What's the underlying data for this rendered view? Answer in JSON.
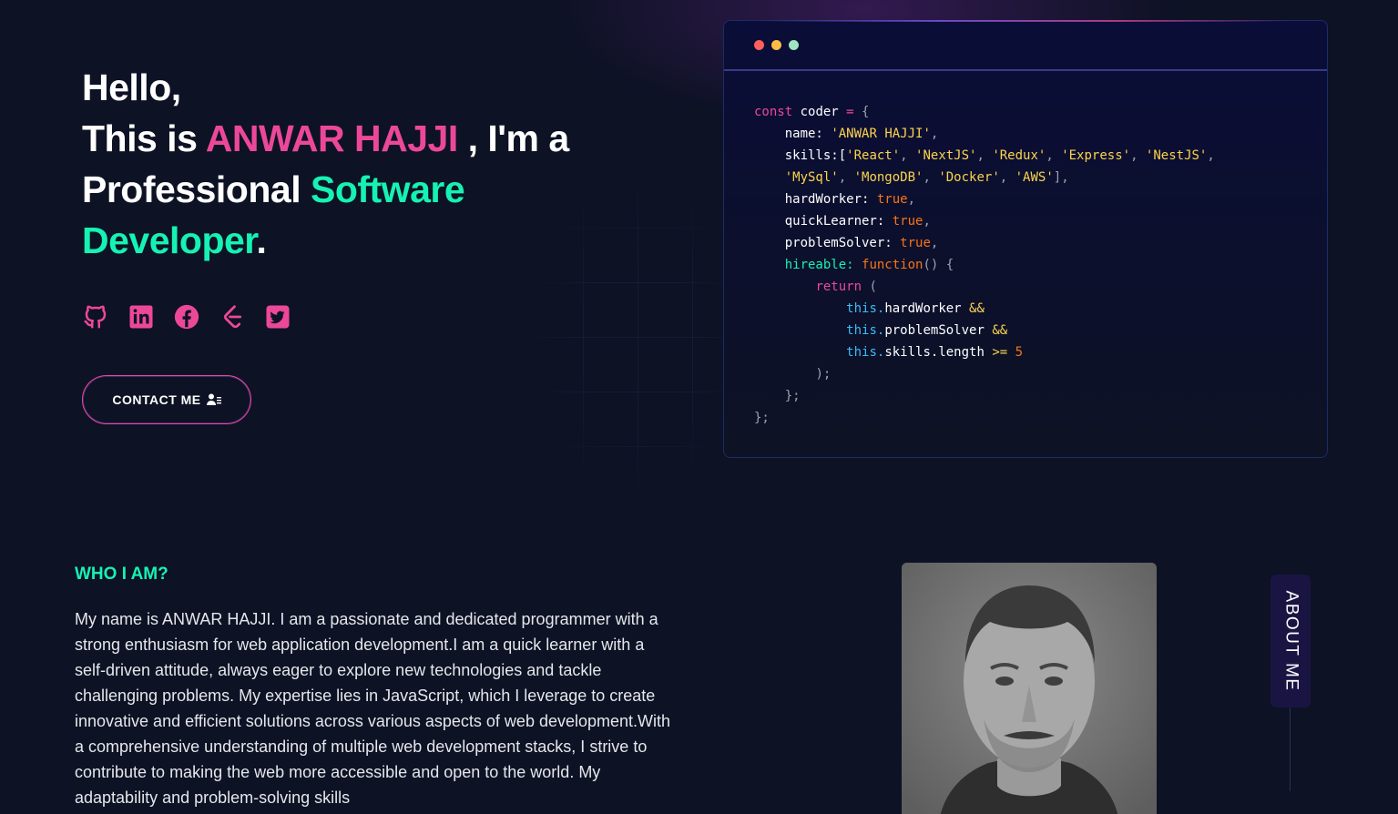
{
  "hero": {
    "line1": "Hello,",
    "line2_prefix": "This is ",
    "name": "ANWAR HAJJI",
    "line2_suffix": " , I'm a",
    "line3_prefix": "Professional ",
    "role_word1": "Software",
    "role_word2": "Developer",
    "period": ".",
    "contact_label": "CONTACT ME"
  },
  "social_icons": [
    "github-icon",
    "linkedin-icon",
    "facebook-icon",
    "leetcode-icon",
    "twitter-icon"
  ],
  "code_window": {
    "dots": [
      "#ff605c",
      "#ffbd44",
      "#9fe5c0"
    ],
    "lines": {
      "l1_kw": "const",
      "l1_name": " coder ",
      "l1_op": "=",
      "l1_open": " {",
      "l2_key": "name:",
      "l2_val": "'ANWAR HAJJI'",
      "l2_end": ",",
      "l3_key": "skills:[",
      "skills": [
        "'React'",
        "'NextJS'",
        "'Redux'",
        "'Express'",
        "'NestJS'",
        "'MySql'",
        "'MongoDB'",
        "'Docker'",
        "'AWS'"
      ],
      "l5_key": "hardWorker:",
      "l5_val": "true",
      "l6_key": "quickLearner:",
      "l6_val": "true",
      "l7_key": "problemSolver:",
      "l7_val": "true",
      "l8_key": "hireable:",
      "l8_fn": "function",
      "l8_rest": "() {",
      "l9_kw": "return",
      "l9_rest": " (",
      "this": "this.",
      "l10_prop": "hardWorker",
      "l11_prop": "problemSolver",
      "l12_prop": "skills.length",
      "and": "&&",
      "gte": ">=",
      "five": "5",
      "close1": ");",
      "close2": "};",
      "close3": "};"
    }
  },
  "about": {
    "title": "WHO I AM?",
    "text": "My name is ANWAR HAJJI. I am a passionate and dedicated programmer with a strong enthusiasm for web application development.I am a quick learner with a self-driven attitude, always eager to explore new technologies and tackle challenging problems. My expertise lies in JavaScript, which I leverage to create innovative and efficient solutions across various aspects of web development.With a comprehensive understanding of multiple web development stacks, I strive to contribute to making the web more accessible and open to the world. My adaptability and problem-solving skills",
    "side_tab": "ABOUT ME"
  },
  "colors": {
    "background": "#0d1224",
    "accent_pink": "#ec4899",
    "accent_green": "#16f2b3"
  }
}
